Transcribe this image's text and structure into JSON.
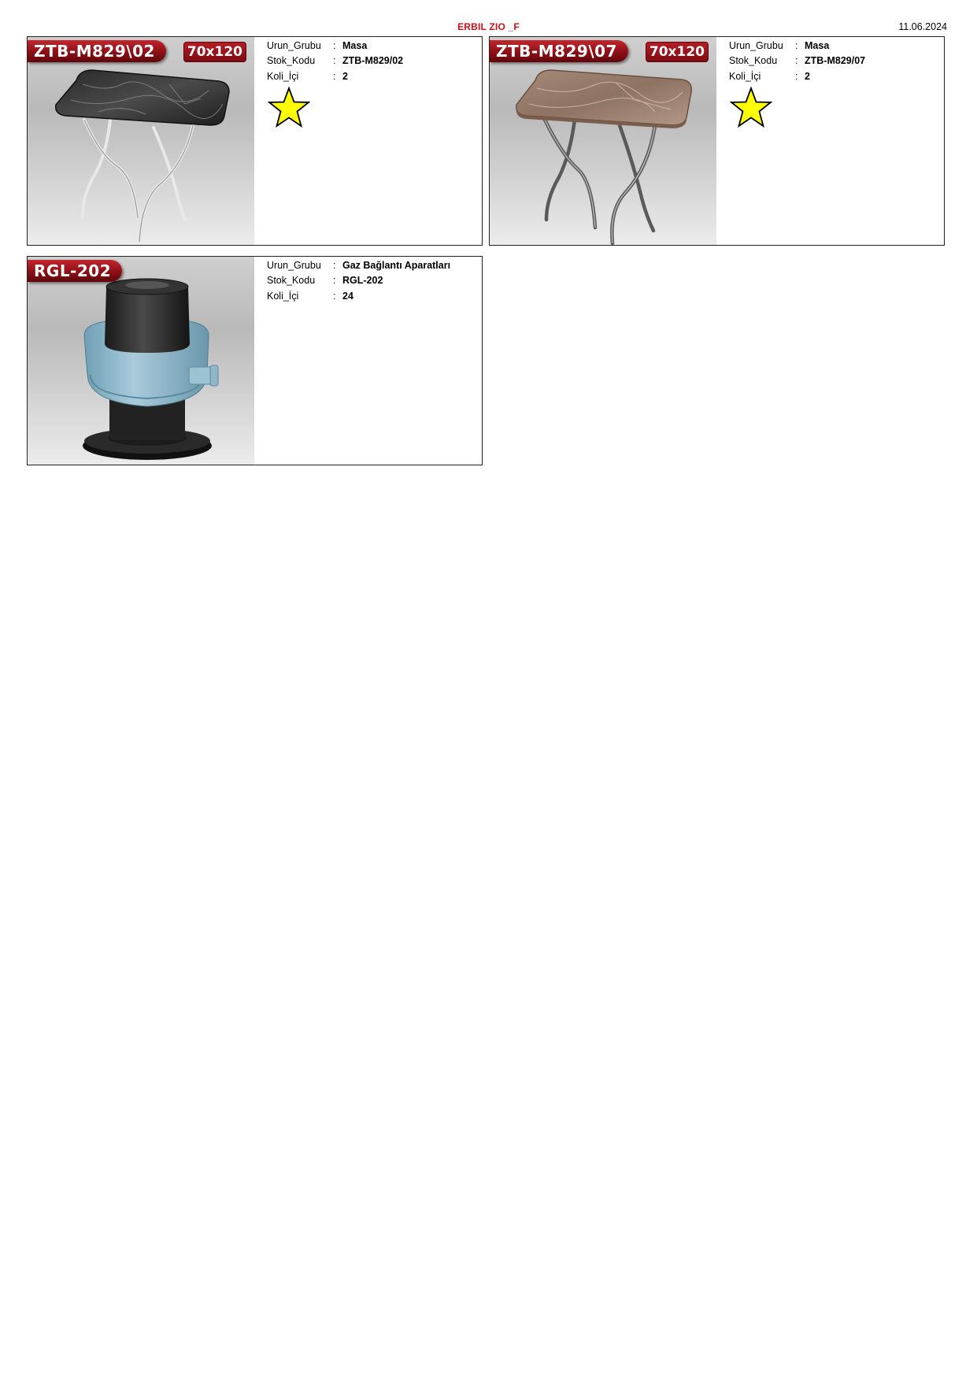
{
  "header": {
    "title": "ERBIL ZIO _F",
    "date": "11.06.2024"
  },
  "products": [
    {
      "code_badge": "ZTB-M829\\02",
      "size_badge": "70x120",
      "rows": [
        {
          "label": "Urun_Grubu",
          "sep": ":",
          "value": "Masa"
        },
        {
          "label": "Stok_Kodu",
          "sep": ":",
          "value": "ZTB-M829/02"
        },
        {
          "label": "Koli_İçi",
          "sep": ":",
          "value": "2"
        }
      ],
      "starred": true,
      "image": "black-marble-folding-table"
    },
    {
      "code_badge": "ZTB-M829\\07",
      "size_badge": "70x120",
      "rows": [
        {
          "label": "Urun_Grubu",
          "sep": ":",
          "value": "Masa"
        },
        {
          "label": "Stok_Kodu",
          "sep": ":",
          "value": "ZTB-M829/07"
        },
        {
          "label": "Koli_İçi",
          "sep": ":",
          "value": "2"
        }
      ],
      "starred": true,
      "image": "brown-marble-folding-table"
    },
    {
      "code_badge": "RGL-202",
      "rows": [
        {
          "label": "Urun_Grubu",
          "sep": ":",
          "value": "Gaz Bağlantı Aparatları"
        },
        {
          "label": "Stok_Kodu",
          "sep": ":",
          "value": "RGL-202"
        },
        {
          "label": "Koli_İçi",
          "sep": ":",
          "value": "24"
        }
      ],
      "starred": false,
      "image": "gas-regulator"
    }
  ],
  "colors": {
    "accent": "#c8101a",
    "badge_dark": "#7d0c12",
    "star": "#ffff00"
  }
}
